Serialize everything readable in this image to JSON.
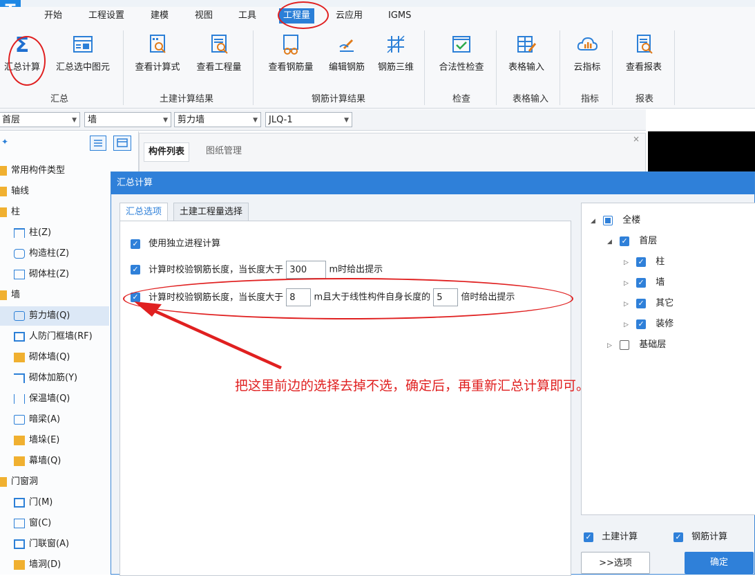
{
  "menu": {
    "tabs": [
      "开始",
      "工程设置",
      "建模",
      "视图",
      "工具",
      "工程量",
      "云应用",
      "IGMS"
    ]
  },
  "ribbon": {
    "groups": [
      {
        "label": "汇总",
        "buttons": [
          "汇总计算",
          "汇总选中图元"
        ]
      },
      {
        "label": "土建计算结果",
        "buttons": [
          "查看计算式",
          "查看工程量"
        ]
      },
      {
        "label": "钢筋计算结果",
        "buttons": [
          "查看钢筋量",
          "编辑钢筋",
          "钢筋三维"
        ]
      },
      {
        "label": "检查",
        "buttons": [
          "合法性检查"
        ]
      },
      {
        "label": "表格输入",
        "buttons": [
          "表格输入"
        ]
      },
      {
        "label": "指标",
        "buttons": [
          "云指标"
        ]
      },
      {
        "label": "报表",
        "buttons": [
          "查看报表"
        ]
      }
    ]
  },
  "selectors": {
    "floor": "首层",
    "category": "墙",
    "type": "剪力墙",
    "component": "JLQ-1"
  },
  "panel_tabs": {
    "list": "构件列表",
    "drawings": "图纸管理"
  },
  "tree": {
    "items": [
      "常用构件类型",
      "轴线",
      "柱",
      "柱(Z)",
      "构造柱(Z)",
      "砌体柱(Z)",
      "墙",
      "剪力墙(Q)",
      "人防门框墙(RF)",
      "砌体墙(Q)",
      "砌体加筋(Y)",
      "保温墙(Q)",
      "暗梁(A)",
      "墙垛(E)",
      "幕墙(Q)",
      "门窗洞",
      "门(M)",
      "窗(C)",
      "门联窗(A)",
      "墙洞(D)"
    ]
  },
  "dialog": {
    "title": "汇总计算",
    "tabs": [
      "汇总选项",
      "土建工程量选择"
    ],
    "opt1": "使用独立进程计算",
    "opt2_pre": "计算时校验钢筋长度，当长度大于",
    "opt2_val": "300",
    "opt2_post": "m时给出提示",
    "opt3_pre": "计算时校验钢筋长度，当长度大于",
    "opt3_val1": "8",
    "opt3_mid": "m且大于线性构件自身长度的",
    "opt3_val2": "5",
    "opt3_post": "倍时给出提示",
    "floor_tree": {
      "all": "全楼",
      "first": "首层",
      "children": [
        "柱",
        "墙",
        "其它",
        "装修"
      ],
      "base": "基础层"
    },
    "civil_calc": "土建计算",
    "rebar_calc": "钢筋计算",
    "options_btn": ">>选项",
    "ok_btn": "确定"
  },
  "annotation": {
    "text": "把这里前边的选择去掉不选，确定后，再重新汇总计算即可。"
  }
}
